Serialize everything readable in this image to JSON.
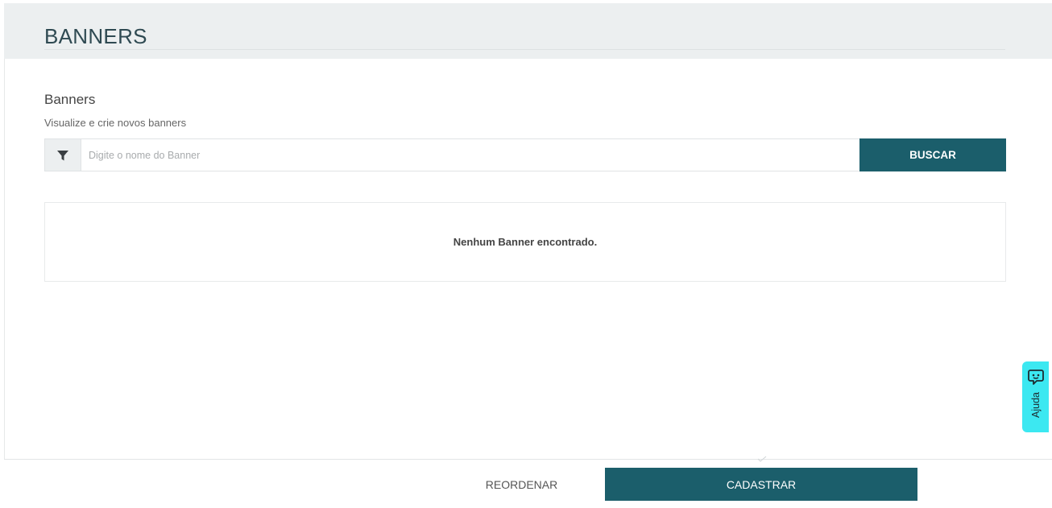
{
  "header": {
    "title": "BANNERS"
  },
  "section": {
    "title": "Banners",
    "subtitle": "Visualize e crie novos banners"
  },
  "search": {
    "placeholder": "Digite o nome do Banner",
    "value": "",
    "button_label": "BUSCAR",
    "filter_icon": "filter-icon"
  },
  "results": {
    "empty_message": "Nenhum Banner encontrado."
  },
  "help": {
    "label": "Ajuda",
    "icon": "chat-bubble-icon",
    "color": "#3ce8f1"
  },
  "footer": {
    "reorder_label": "REORDENAR",
    "register_label": "CADASTRAR"
  },
  "colors": {
    "primary": "#1b5e6b",
    "header_bg": "#eceff0"
  }
}
